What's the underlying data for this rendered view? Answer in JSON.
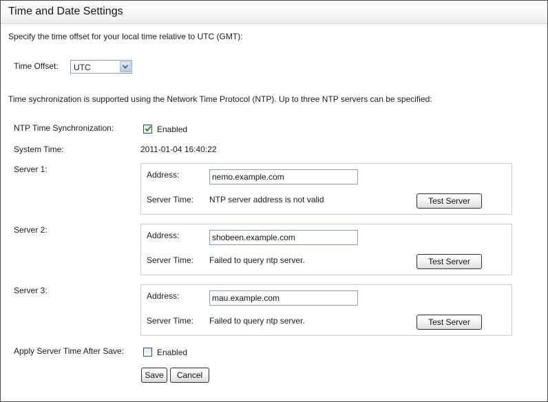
{
  "page": {
    "title": "Time and Date Settings",
    "offset_intro": "Specify the time offset for your local time relative to UTC (GMT):",
    "ntp_intro": "Time sychronization is supported using the Network Time Protocol (NTP). Up to three NTP servers can be specified:"
  },
  "time_offset": {
    "label": "Time Offset:",
    "selected": "UTC"
  },
  "ntp_sync": {
    "label": "NTP Time Synchronization:",
    "checked": true,
    "option_label": "Enabled"
  },
  "system_time": {
    "label": "System Time:",
    "value": "2011-01-04 16:40:22"
  },
  "servers": [
    {
      "label": "Server 1:",
      "address_label": "Address:",
      "address": "nemo.example.com",
      "server_time_label": "Server Time:",
      "server_time": "NTP server address is not valid",
      "test_label": "Test Server"
    },
    {
      "label": "Server 2:",
      "address_label": "Address:",
      "address": "shobeen.example.com",
      "server_time_label": "Server Time:",
      "server_time": "Failed to query ntp server.",
      "test_label": "Test Server"
    },
    {
      "label": "Server 3:",
      "address_label": "Address:",
      "address": "mau.example.com",
      "server_time_label": "Server Time:",
      "server_time": "Failed to query ntp server.",
      "test_label": "Test Server"
    }
  ],
  "apply_server_time": {
    "label": "Apply Server Time After Save:",
    "checked": false,
    "option_label": "Enabled"
  },
  "actions": {
    "save_label": "Save",
    "cancel_label": "Cancel"
  },
  "icons": {
    "dropdown": "chevron-down-icon",
    "checkmark": "checkmark-icon"
  },
  "colors": {
    "checkmark": "#2a8a2a",
    "input_border": "#7f9db9",
    "box_border": "#cccccc"
  }
}
